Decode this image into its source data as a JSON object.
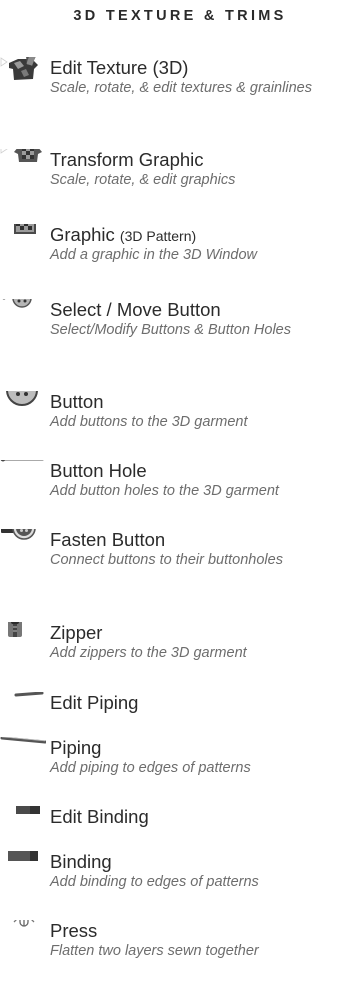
{
  "header": "3D TEXTURE & TRIMS",
  "tools": [
    {
      "title": "Edit Texture (3D)",
      "description": "Scale, rotate, & edit textures & grainlines",
      "icon": "edit-texture-icon"
    },
    {
      "title": "Transform Graphic",
      "description": "Scale, rotate, & edit graphics",
      "icon": "transform-graphic-icon"
    },
    {
      "title": "Graphic",
      "title_suffix": "(3D Pattern)",
      "description": "Add a graphic in the 3D Window",
      "icon": "graphic-icon"
    },
    {
      "title": "Select / Move Button",
      "description": "Select/Modify Buttons & Button Holes",
      "icon": "select-move-button-icon"
    },
    {
      "title": "Button",
      "description": "Add buttons to the 3D garment",
      "icon": "button-icon"
    },
    {
      "title": "Button Hole",
      "description": "Add button holes to the 3D garment",
      "icon": "button-hole-icon"
    },
    {
      "title": "Fasten Button",
      "description": "Connect buttons to their buttonholes",
      "icon": "fasten-button-icon"
    },
    {
      "title": "Zipper",
      "description": "Add zippers to the 3D garment",
      "icon": "zipper-icon"
    },
    {
      "title": "Edit Piping",
      "description": "",
      "icon": "edit-piping-icon"
    },
    {
      "title": "Piping",
      "description": "Add piping to edges of patterns",
      "icon": "piping-icon"
    },
    {
      "title": "Edit Binding",
      "description": "",
      "icon": "edit-binding-icon"
    },
    {
      "title": "Binding",
      "description": "Add binding to edges of patterns",
      "icon": "binding-icon"
    },
    {
      "title": "Press",
      "description": "Flatten two layers sewn together",
      "icon": "press-icon"
    }
  ]
}
